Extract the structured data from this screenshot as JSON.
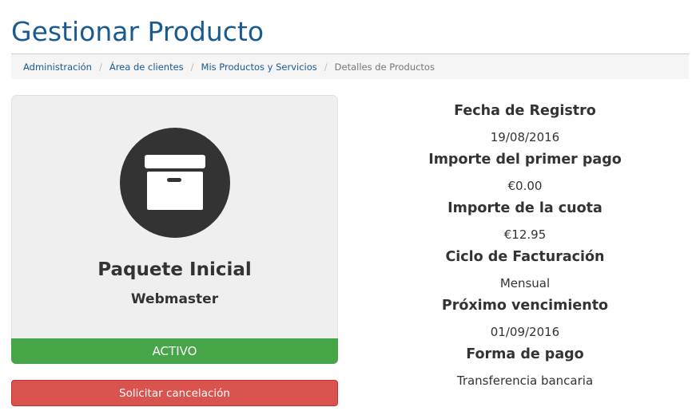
{
  "page": {
    "title": "Gestionar Producto"
  },
  "breadcrumb": {
    "items": [
      {
        "label": "Administración"
      },
      {
        "label": "Área de clientes"
      },
      {
        "label": "Mis Productos y Servicios"
      }
    ],
    "active": "Detalles de Productos",
    "separator": "/"
  },
  "product": {
    "icon": "archive-box-icon",
    "name": "Paquete Inicial",
    "group": "Webmaster",
    "status": "ACTIVO",
    "cancel_label": "Solicitar cancelación"
  },
  "details": [
    {
      "label": "Fecha de Registro",
      "value": "19/08/2016"
    },
    {
      "label": "Importe del primer pago",
      "value": "€0.00"
    },
    {
      "label": "Importe de la cuota",
      "value": "€12.95"
    },
    {
      "label": "Ciclo de Facturación",
      "value": "Mensual"
    },
    {
      "label": "Próximo vencimiento",
      "value": "01/09/2016"
    },
    {
      "label": "Forma de pago",
      "value": "Transferencia bancaria"
    }
  ],
  "colors": {
    "title": "#1a5a8f",
    "status_active": "#46a546",
    "cancel": "#d9534f",
    "card_bg": "#efefef",
    "icon_circle": "#333333"
  }
}
